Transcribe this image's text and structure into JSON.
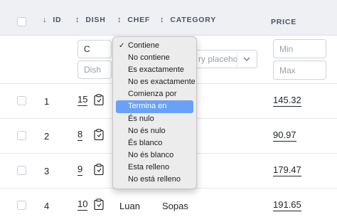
{
  "header": {
    "id": "ID",
    "dish": "DISH",
    "chef": "CHEF",
    "category": "CATEGORY",
    "price": "PRICE",
    "sort_icon": "↓",
    "sortable_icon": "↕"
  },
  "filters": {
    "dish_operator": "C",
    "dish_placeholder": "Dish",
    "category_placeholder": "ry placeho",
    "price_min_placeholder": "Min",
    "price_max_placeholder": "Max"
  },
  "rows": [
    {
      "index": "1",
      "id": "15",
      "chef": "",
      "category": "",
      "price": "145.32"
    },
    {
      "index": "2",
      "id": "8",
      "chef": "",
      "category": "",
      "price": "90.97"
    },
    {
      "index": "3",
      "id": "9",
      "chef": "",
      "category": "",
      "price": "179.47"
    },
    {
      "index": "4",
      "id": "10",
      "chef": "Luan",
      "category": "Sopas",
      "price": "191.65"
    }
  ],
  "filter_menu": {
    "checkmark": "✓",
    "items": [
      "Contiene",
      "No contiene",
      "Es exactamente",
      "No es exactamente",
      "Comienza por",
      "Termina en",
      "És nulo",
      "No és nulo",
      "És blanco",
      "No és blanco",
      "Esta relleno",
      "No está relleno"
    ],
    "checked_index": 0,
    "highlighted_index": 5
  }
}
